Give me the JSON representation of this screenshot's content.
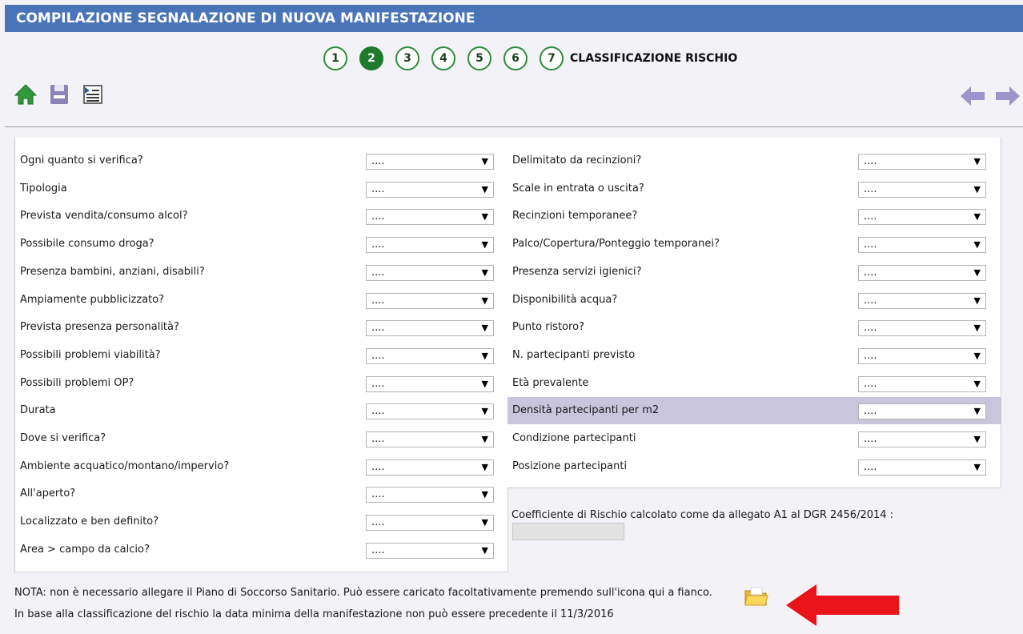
{
  "header": {
    "title": "COMPILAZIONE SEGNALAZIONE DI NUOVA MANIFESTAZIONE"
  },
  "steps": [
    "1",
    "2",
    "3",
    "4",
    "5",
    "6",
    "7"
  ],
  "active_step": "2",
  "step_label": "CLASSIFICAZIONE RISCHIO",
  "toolbar": {
    "icons": [
      "home-icon",
      "save-icon",
      "export-icon"
    ]
  },
  "nav": {
    "icons": [
      "arrow-left-icon",
      "arrow-right-icon"
    ]
  },
  "select_placeholder": "....",
  "left_fields": [
    "Ogni quanto si verifica?",
    "Tipologia",
    "Prevista vendita/consumo alcol?",
    "Possibile consumo droga?",
    "Presenza bambini, anziani, disabili?",
    "Ampiamente pubblicizzato?",
    "Prevista presenza personalità?",
    "Possibili problemi viabilità?",
    "Possibili problemi OP?",
    "Durata",
    "Dove si verifica?",
    "Ambiente acquatico/montano/impervio?",
    "All'aperto?",
    "Localizzato e ben definito?",
    "Area > campo da calcio?"
  ],
  "right_fields": [
    "Delimitato da recinzioni?",
    "Scale in entrata o uscita?",
    "Recinzioni temporanee?",
    "Palco/Copertura/Ponteggio temporanei?",
    "Presenza servizi igienici?",
    "Disponibilità acqua?",
    "Punto ristoro?",
    "N. partecipanti previsto",
    "Età prevalente",
    "Densità partecipanti per m2",
    "Condizione partecipanti",
    "Posizione partecipanti"
  ],
  "highlighted_right_field": "Densità partecipanti per m2",
  "coefficient": {
    "label": "Coefficiente di Rischio calcolato come da allegato A1 al DGR 2456/2014 :",
    "value": ""
  },
  "notes": {
    "line1": "NOTA: non è necessario allegare il Piano di Soccorso Sanitario. Può essere caricato facoltativamente premendo sull'icona qui a fianco.",
    "line2": "In base alla classificazione del rischio la data minima della manifestazione non può essere precedente il 11/3/2016"
  },
  "colors": {
    "title_bar": "#4a74b8",
    "step_active": "#1f7a2e",
    "highlight_row": "#c8c5dd",
    "annotation_arrow": "#e8141a"
  }
}
